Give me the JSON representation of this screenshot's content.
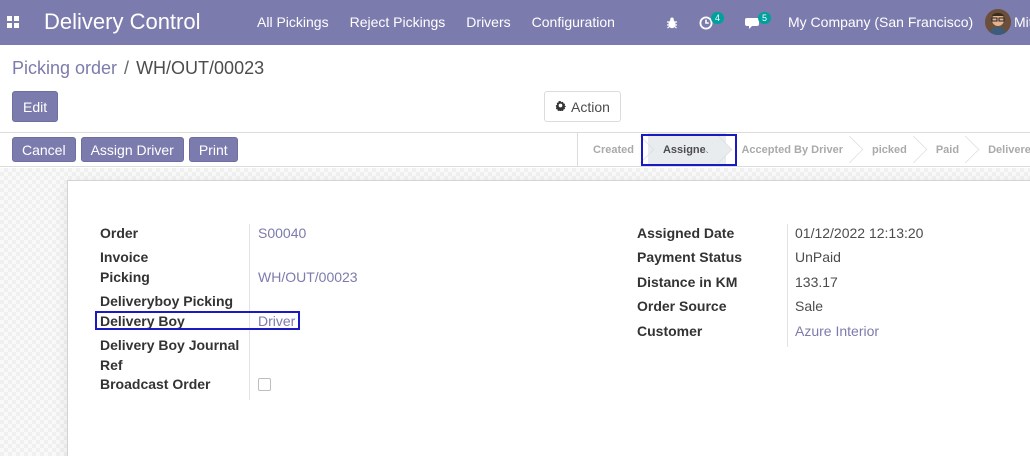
{
  "navbar": {
    "brand": "Delivery Control",
    "menu": [
      "All Pickings",
      "Reject Pickings",
      "Drivers",
      "Configuration"
    ],
    "activity_count": "4",
    "message_count": "5",
    "company": "My Company (San Francisco)",
    "user": "Mit"
  },
  "breadcrumb": {
    "parent": "Picking order",
    "separator": "/",
    "current": "WH/OUT/00023"
  },
  "control": {
    "edit_label": "Edit",
    "action_label": "Action"
  },
  "statusbar": {
    "buttons": [
      "Cancel",
      "Assign Driver",
      "Print"
    ],
    "stages": [
      "Created",
      "Assigned",
      "Accepted By Driver",
      "picked",
      "Paid",
      "Delivered"
    ],
    "active_stage": "Assigned"
  },
  "form": {
    "left": {
      "order_label": "Order",
      "order_value": "S00040",
      "invoice_label": "Invoice",
      "picking_label": "Picking",
      "picking_value": "WH/OUT/00023",
      "deliveryboy_picking_label": "Deliveryboy Picking",
      "delivery_boy_label": "Delivery Boy",
      "delivery_boy_value": "Driver",
      "journal_label_line1": "Delivery Boy Journal",
      "journal_label_line2": "Ref",
      "broadcast_label": "Broadcast Order"
    },
    "right": {
      "assigned_date_label": "Assigned Date",
      "assigned_date_value": "01/12/2022 12:13:20",
      "payment_status_label": "Payment Status",
      "payment_status_value": "UnPaid",
      "distance_label": "Distance in KM",
      "distance_value": "133.17",
      "order_source_label": "Order Source",
      "order_source_value": "Sale",
      "customer_label": "Customer",
      "customer_value": "Azure Interior"
    }
  },
  "colors": {
    "brand": "#7c7bad",
    "highlight_border": "#1a1ac0",
    "badge": "#00a09d"
  }
}
